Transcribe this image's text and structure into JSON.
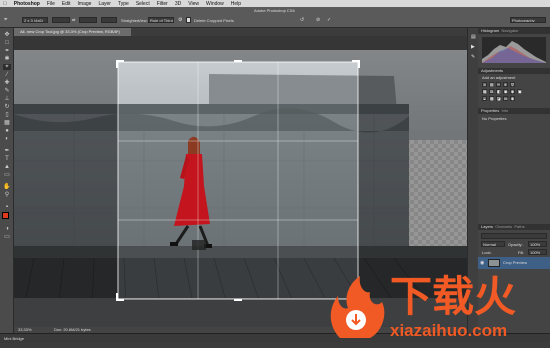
{
  "menubar": {
    "app_name": "Photoshop",
    "items": [
      "File",
      "Edit",
      "Image",
      "Layer",
      "Type",
      "Select",
      "Filter",
      "3D",
      "View",
      "Window",
      "Help"
    ],
    "window_title": "Adobe Photoshop CS6"
  },
  "options": {
    "ratio": "2 x 3 (4x6)",
    "straighten_label": "Straighten",
    "view_label": "View:",
    "view_value": "Rule of Thirds",
    "delete_label": "Delete Cropped Pixels",
    "workspace": "Photography"
  },
  "document": {
    "tab_title": "All- new Crop Tool.jpg @ 33.3% (Crop Preview, RGB/8*)",
    "zoom": "33.33%",
    "doc_size": "Doc: 20.6M/21 bytes"
  },
  "minibridge": {
    "label": "Mini Bridge"
  },
  "panels": {
    "histogram_tab": "Histogram",
    "navigator_tab": "Navigator",
    "adjustments_tab": "Adjustments",
    "adjustments_hint": "Add an adjustment",
    "properties_tab": "Properties",
    "info_tab": "Info",
    "properties_value": "No Properties",
    "layers_tab": "Layers",
    "channels_tab": "Channels",
    "paths_tab": "Paths",
    "blend_mode": "Normal",
    "opacity_label": "Opacity:",
    "opacity_value": "100%",
    "lock_label": "Lock:",
    "fill_label": "Fill:",
    "fill_value": "100%",
    "layer_name": "Crop Preview"
  },
  "watermark": {
    "text_cn": "下载火",
    "text_url": "xiazaihuo.com"
  },
  "colors": {
    "accent_red": "#e03a1e",
    "watermark_orange": "#f15a24"
  }
}
